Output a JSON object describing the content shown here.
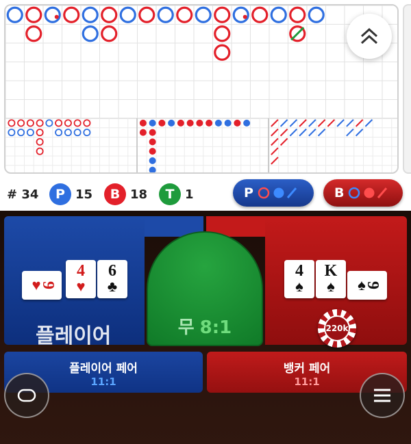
{
  "colors": {
    "player": "#2f6fe0",
    "banker": "#e3202a",
    "tie": "#1e9b3c"
  },
  "big_road": [
    [
      "P"
    ],
    [
      "B",
      "B"
    ],
    [
      "P"
    ],
    [
      "B"
    ],
    [
      "P",
      "P"
    ],
    [
      "B",
      "B"
    ],
    [
      "P"
    ],
    [
      "B"
    ],
    [
      "P"
    ],
    [
      "B"
    ],
    [
      "P"
    ],
    [
      "B",
      "B",
      "B"
    ],
    [
      "P"
    ],
    [
      "B"
    ],
    [
      "P"
    ],
    [
      "B",
      "B"
    ],
    [
      "P"
    ]
  ],
  "big_road_tie_marks": [
    {
      "col": 2
    },
    {
      "col": 12
    }
  ],
  "big_road_pair_marks": [
    {
      "col": 15,
      "row": 1
    }
  ],
  "bead_road": [
    [
      "B",
      "P"
    ],
    [
      "B",
      "P"
    ],
    [
      "B",
      "P"
    ],
    [
      "B",
      "B",
      "B",
      "B"
    ],
    [
      "P"
    ],
    [
      "B",
      "P"
    ],
    [
      "B",
      "P"
    ],
    [
      "B",
      "P"
    ],
    [
      "B",
      "P"
    ]
  ],
  "small_road": [
    [
      "R",
      "R"
    ],
    [
      "B",
      "R",
      "R",
      "R",
      "B",
      "B",
      "B"
    ],
    [
      "R"
    ],
    [
      "B"
    ],
    [
      "R"
    ],
    [
      "R"
    ],
    [
      "R"
    ],
    [
      "R"
    ],
    [
      "B"
    ],
    [
      "B"
    ],
    [
      "R"
    ],
    [
      "B"
    ]
  ],
  "cockroach_road": [
    [
      "R",
      "R",
      "R",
      "R",
      "R"
    ],
    [
      "B",
      "R",
      "R"
    ],
    [
      "B",
      "B"
    ],
    [
      "R",
      "B"
    ],
    [
      "B",
      "B"
    ],
    [
      "R",
      "B"
    ],
    [
      "R"
    ],
    [
      "B"
    ],
    [
      "B",
      "B"
    ],
    [
      "R",
      "B"
    ],
    [
      "B"
    ]
  ],
  "stats": {
    "round": "# 34",
    "player_letter": "P",
    "player_count": "15",
    "banker_letter": "B",
    "banker_count": "18",
    "tie_letter": "T",
    "tie_count": "1"
  },
  "predict": {
    "player_label": "P",
    "banker_label": "B"
  },
  "bets": {
    "player_label": "플레이어",
    "tie_label": "무",
    "tie_odds": "8:1",
    "player_pair_label": "플레이어 페어",
    "player_pair_odds": "11:1",
    "banker_pair_label": "뱅커 페어",
    "banker_pair_odds": "11:1",
    "chip_value": "220k"
  },
  "player_cards": [
    {
      "rank": "9",
      "suit": "♥",
      "color": "#d21c1c",
      "side": true
    },
    {
      "rank": "4",
      "suit": "♥",
      "color": "#d21c1c"
    },
    {
      "rank": "6",
      "suit": "♣",
      "color": "#111"
    }
  ],
  "banker_cards": [
    {
      "rank": "4",
      "suit": "♠",
      "color": "#111"
    },
    {
      "rank": "K",
      "suit": "♠",
      "color": "#111"
    },
    {
      "rank": "9",
      "suit": "♠",
      "color": "#111",
      "side": true
    }
  ],
  "icons": {
    "collapse": "double-chevron-up-icon",
    "chat": "chat-bubble-icon",
    "menu": "hamburger-menu-icon"
  }
}
